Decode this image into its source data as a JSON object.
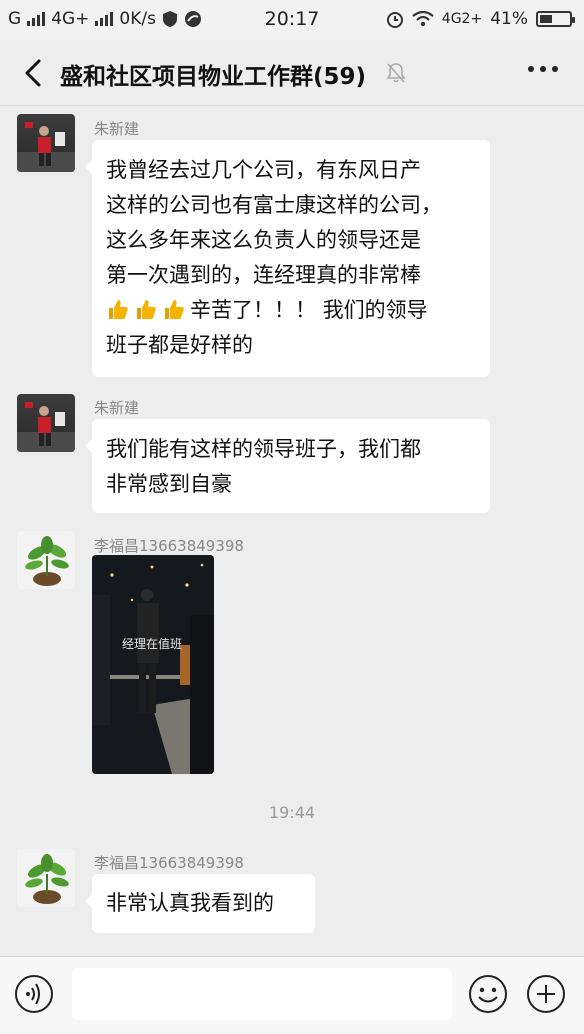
{
  "status_bar": {
    "carrier": "G",
    "network": "4G+",
    "speed": "0K/s",
    "time": "20:17",
    "network_right": "4G2+",
    "battery": "41%"
  },
  "header": {
    "title": "盛和社区项目物业工作群(59)"
  },
  "messages": [
    {
      "sender": "朱新建",
      "lines": [
        "我曾经去过几个公司，有东风日产",
        "这样的公司也有富士康这样的公司，",
        "这么多年来这么负责人的领导还是",
        "第一次遇到的，连经理真的非常棒",
        "辛苦了！！！ 我们的领导",
        "班子都是好样的"
      ]
    },
    {
      "sender": "朱新建",
      "lines": [
        "我们能有这样的领导班子，我们都",
        "非常感到自豪"
      ]
    },
    {
      "sender": "李福昌13663849398",
      "photo_caption": "经理在值班"
    },
    {
      "sender": "李福昌13663849398",
      "lines": [
        "非常认真我看到的"
      ]
    }
  ],
  "timestamp": "19:44",
  "icons": {
    "back": "chevron-left-icon",
    "mute": "bell-off-icon",
    "more": "more-dots-icon",
    "voice": "voice-icon",
    "emoji": "emoji-icon",
    "plus": "plus-icon",
    "thumbs": "thumbs-up-emoji"
  },
  "colors": {
    "background": "#ededed",
    "bubble": "#ffffff",
    "thumb": "#f5b300"
  }
}
